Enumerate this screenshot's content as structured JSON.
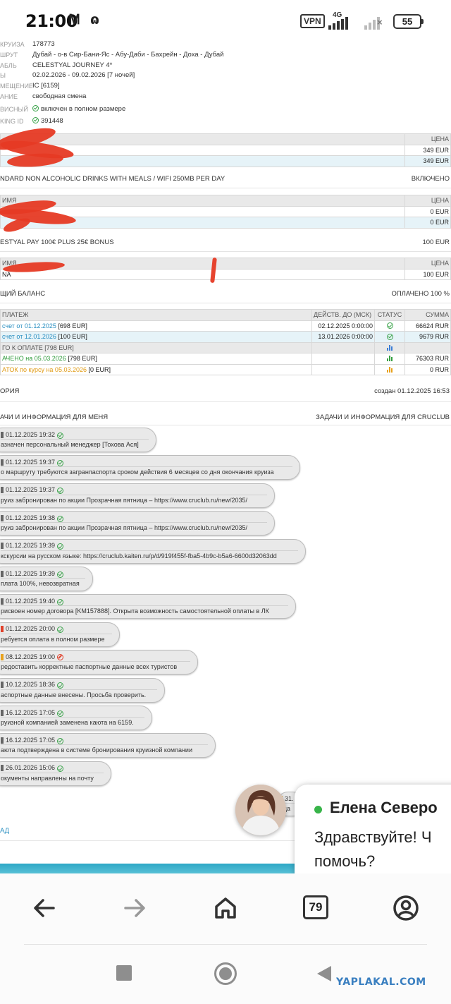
{
  "status_bar": {
    "time": "21:00",
    "notif_icons": [
      "Ꮇ",
      "ɷ"
    ],
    "vpn": "VPN",
    "network": "4G",
    "battery": "55"
  },
  "booking": {
    "rows": [
      {
        "label": "КРУИЗА",
        "value": "178773",
        "type": "link"
      },
      {
        "label": "ШРУТ",
        "value": "Дубай - о-в Сир-Бани-Яс - Абу-Даби - Бахрейн - Доха - Дубай",
        "type": "text"
      },
      {
        "label": "АБЛЬ",
        "value": "CELESTYAL JOURNEY 4*",
        "type": "link"
      },
      {
        "label": "Ы",
        "value": "02.02.2026 - 09.02.2026 [7 ночей]",
        "type": "text"
      },
      {
        "label": "МЕЩЕНИЕ",
        "value": "IC [6159]",
        "type": "text"
      },
      {
        "label": "АНИЕ",
        "value": "свободная смена",
        "type": "text"
      },
      {
        "label": "ВИСНЫЙ",
        "value": "включен в полном размере",
        "type": "check"
      },
      {
        "label": "KING ID",
        "value": "391448",
        "type": "checklink"
      }
    ]
  },
  "table1": {
    "header_price": "ЦЕНА",
    "rows": [
      {
        "price": "349 EUR"
      },
      {
        "price": "349 EUR"
      }
    ]
  },
  "section_drinks": {
    "left": "NDARD NON ALCOHOLIC DRINKS WITH MEALS / WIFI 250MB PER DAY",
    "right": "ВКЛЮЧЕНО"
  },
  "table2": {
    "header_name": "ИМЯ",
    "header_price": "ЦЕНА",
    "rows": [
      {
        "price": "0 EUR"
      },
      {
        "price": "0 EUR"
      }
    ]
  },
  "section_bonus": {
    "left": "ESTYAL PAY 100€ PLUS 25€ BONUS",
    "right": "100 EUR"
  },
  "table3": {
    "header_name": "ИМЯ",
    "header_price": "ЦЕНА",
    "rows": [
      {
        "name": "NA",
        "price": "100 EUR"
      }
    ]
  },
  "section_balance": {
    "left": "ЩИЙ БАЛАНС",
    "right": "ОПЛАЧЕНО 100 %"
  },
  "payments": {
    "headers": {
      "payment": "ПЛАТЕЖ",
      "valid": "ДЕЙСТВ. ДО (МСК)",
      "status": "СТАТУС",
      "sum": "СУММА"
    },
    "rows": [
      {
        "link": "счет от 01.12.2025",
        "extra": " [698 EUR]",
        "valid": "02.12.2025 0:00:00",
        "status": "ok",
        "sum": "66624 RUR"
      },
      {
        "link": "счет от 12.01.2026",
        "extra": " [100 EUR]",
        "valid": "13.01.2026 0:00:00",
        "status": "ok",
        "sum": "9679 RUR"
      }
    ],
    "total": "ГО К ОПЛАТЕ [798 EUR]",
    "paid": {
      "link": "АЧЕНО на 05.03.2026",
      "extra": " [798 EUR]",
      "sum": "76303 RUR"
    },
    "rest": {
      "link": "АТОК по курсу на 05.03.2026",
      "extra": " [0 EUR]",
      "sum": "0 RUR"
    },
    "colors": {
      "paid": "#2e9a3a",
      "rest": "#e09a12",
      "bar_blue": "#3d7fd6",
      "bar_green": "#37a043",
      "bar_orange": "#e8a21d"
    }
  },
  "section_history": {
    "left": "ОРИЯ",
    "right": "создан 01.12.2025 16:53"
  },
  "tasks": {
    "left": "АЧИ И ИНФОРМАЦИЯ ДЛЯ МЕНЯ",
    "right": "ЗАДАЧИ И ИНФОРМАЦИЯ ДЛЯ CRUCLUB"
  },
  "messages": [
    {
      "date": "01.12.2025 19:32",
      "status": "ok",
      "person": "gray",
      "text": "азначен персональный менеджер [Тохова Ася]"
    },
    {
      "date": "01.12.2025 19:37",
      "status": "ok",
      "person": "gray",
      "text": "о маршруту требуются загранпаспорта сроком действия 6 месяцев со дня окончания круиза"
    },
    {
      "date": "01.12.2025 19:37",
      "status": "ok",
      "person": "gray",
      "text": "руиз забронирован по акции Прозрачная пятница – https://www.cruclub.ru/new/2035/"
    },
    {
      "date": "01.12.2025 19:38",
      "status": "ok",
      "person": "gray",
      "text": "руиз забронирован по акции Прозрачная пятница – https://www.cruclub.ru/new/2035/"
    },
    {
      "date": "01.12.2025 19:39",
      "status": "ok",
      "person": "gray",
      "text": "кскурсии на русском языке: https://cruclub.kaiten.ru/p/d/919f455f-fba5-4b9c-b5a6-6600d32063dd"
    },
    {
      "date": "01.12.2025 19:39",
      "status": "ok",
      "person": "gray",
      "text": "плата 100%, невозвратная"
    },
    {
      "date": "01.12.2025 19:40",
      "status": "ok",
      "person": "gray",
      "text": "рисвоен номер договора [KM157888]. Открыта возможность самостоятельной оплаты в ЛК"
    },
    {
      "date": "01.12.2025 20:00",
      "status": "ok",
      "person": "red",
      "text": "ребуется оплата в полном размере"
    },
    {
      "date": "08.12.2025 19:00",
      "status": "no",
      "person": "orange",
      "text": "редоставить корректные паспортные данные всех туристов"
    },
    {
      "date": "10.12.2025 18:36",
      "status": "ok",
      "person": "gray",
      "text": "аспортные данные внесены. Просьба проверить."
    },
    {
      "date": "16.12.2025 17:05",
      "status": "ok",
      "person": "gray",
      "text": "руизной компанией заменена каюта на 6159."
    },
    {
      "date": "16.12.2025 17:05",
      "status": "ok",
      "person": "gray",
      "text": "аюта подтверждена в системе бронирования круизной компании"
    },
    {
      "date": "26.01.2026 15:06",
      "status": "ok",
      "person": "gray",
      "text": "окументы направлены на почту"
    }
  ],
  "peek_msg": {
    "date": "31.",
    "text": "еда"
  },
  "back_link": "АД",
  "chat_widget": {
    "name": "Елена Северо",
    "message": "Здравствуйте! Ч помочь?"
  },
  "browser_nav": {
    "tabs_count": "79"
  },
  "watermark": "YAPLAKAL.COM"
}
